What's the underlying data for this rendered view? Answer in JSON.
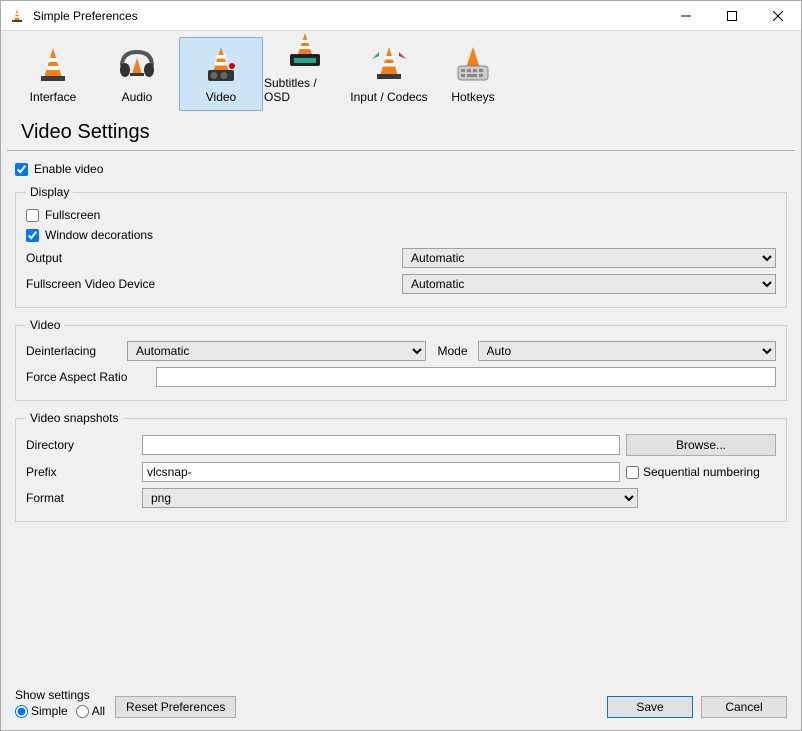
{
  "window": {
    "title": "Simple Preferences"
  },
  "tabs": [
    {
      "label": "Interface"
    },
    {
      "label": "Audio"
    },
    {
      "label": "Video"
    },
    {
      "label": "Subtitles / OSD"
    },
    {
      "label": "Input / Codecs"
    },
    {
      "label": "Hotkeys"
    }
  ],
  "heading": "Video Settings",
  "enable_video": {
    "label": "Enable video",
    "checked": true
  },
  "display": {
    "legend": "Display",
    "fullscreen": {
      "label": "Fullscreen",
      "checked": false
    },
    "window_decorations": {
      "label": "Window decorations",
      "checked": true
    },
    "output": {
      "label": "Output",
      "value": "Automatic"
    },
    "fullscreen_device": {
      "label": "Fullscreen Video Device",
      "value": "Automatic"
    }
  },
  "video": {
    "legend": "Video",
    "deinterlacing": {
      "label": "Deinterlacing",
      "value": "Automatic"
    },
    "mode": {
      "label": "Mode",
      "value": "Auto"
    },
    "force_aspect": {
      "label": "Force Aspect Ratio",
      "value": ""
    }
  },
  "snapshots": {
    "legend": "Video snapshots",
    "directory": {
      "label": "Directory",
      "value": "",
      "browse": "Browse..."
    },
    "prefix": {
      "label": "Prefix",
      "value": "vlcsnap-"
    },
    "sequential": {
      "label": "Sequential numbering",
      "checked": false
    },
    "format": {
      "label": "Format",
      "value": "png"
    }
  },
  "footer": {
    "show_settings": "Show settings",
    "simple": "Simple",
    "all": "All",
    "reset": "Reset Preferences",
    "save": "Save",
    "cancel": "Cancel"
  }
}
